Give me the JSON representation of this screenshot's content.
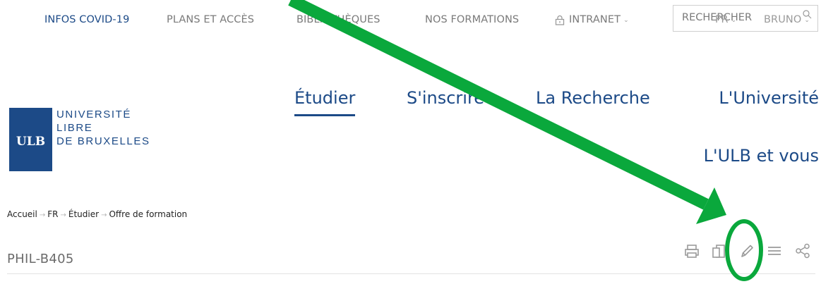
{
  "topnav": {
    "covid": "INFOS COVID-19",
    "plans": "PLANS ET ACCÈS",
    "biblio": "BIBLIOTHÈQUES",
    "formations": "NOS FORMATIONS",
    "intranet": "INTRANET",
    "search_placeholder": "RECHERCHER",
    "lang": "FR",
    "user": "BRUNO"
  },
  "logo": {
    "badge": "ULB",
    "line1": "UNIVERSITÉ",
    "line2": "LIBRE",
    "line3": "DE BRUXELLES"
  },
  "mainnav": {
    "etudier": "Étudier",
    "inscrire": "S'inscrire",
    "recherche": "La Recherche",
    "universite": "L'Université",
    "ulb_vous": "L'ULB et vous"
  },
  "breadcrumb": {
    "items": [
      "Accueil",
      "FR",
      "Étudier",
      "Offre de formation"
    ],
    "separator": "→"
  },
  "page": {
    "title": "PHIL-B405"
  },
  "tools": [
    "print-icon",
    "pdf-icon",
    "edit-icon",
    "menu-icon",
    "share-icon"
  ],
  "colors": {
    "brand": "#1c4a87",
    "annotation": "#0aa83c",
    "muted": "#7a7a7a"
  }
}
